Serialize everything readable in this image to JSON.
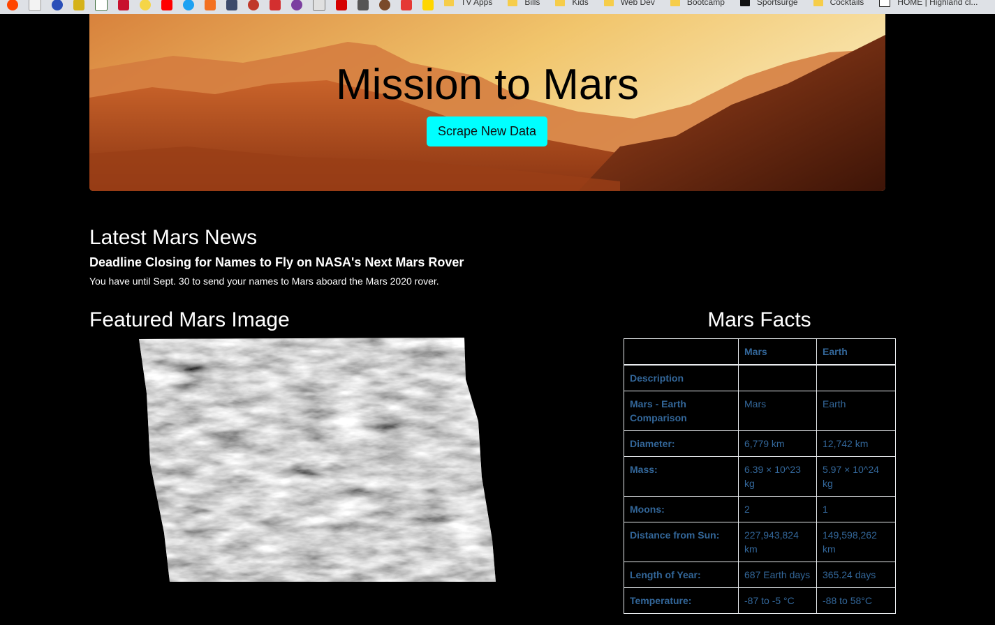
{
  "bookmarks": {
    "folders": [
      "TV Apps",
      "Bills",
      "Kids",
      "Web Dev",
      "Bootcamp",
      "Sportsurge",
      "Cocktails",
      "HOME | Highland cl..."
    ]
  },
  "header": {
    "title": "Mission to Mars",
    "scrape_button": "Scrape New Data"
  },
  "news": {
    "heading": "Latest Mars News",
    "title": "Deadline Closing for Names to Fly on NASA's Next Mars Rover",
    "paragraph": "You have until Sept. 30 to send your names to Mars aboard the Mars 2020 rover."
  },
  "featured_image": {
    "heading": "Featured Mars Image"
  },
  "facts": {
    "heading": "Mars Facts",
    "columns": [
      "",
      "Mars",
      "Earth"
    ],
    "rows": [
      {
        "label": "Description",
        "mars": "",
        "earth": ""
      },
      {
        "label": "Mars - Earth Comparison",
        "mars": "Mars",
        "earth": "Earth"
      },
      {
        "label": "Diameter:",
        "mars": "6,779 km",
        "earth": "12,742 km"
      },
      {
        "label": "Mass:",
        "mars": "6.39 × 10^23 kg",
        "earth": "5.97 × 10^24 kg"
      },
      {
        "label": "Moons:",
        "mars": "2",
        "earth": "1"
      },
      {
        "label": "Distance from Sun:",
        "mars": "227,943,824 km",
        "earth": "149,598,262 km"
      },
      {
        "label": "Length of Year:",
        "mars": "687 Earth days",
        "earth": "365.24 days"
      },
      {
        "label": "Temperature:",
        "mars": "-87 to -5 °C",
        "earth": "-88 to 58°C"
      }
    ]
  },
  "colors": {
    "background": "#000000",
    "button": "#00ffff",
    "table_text": "#33679a"
  }
}
